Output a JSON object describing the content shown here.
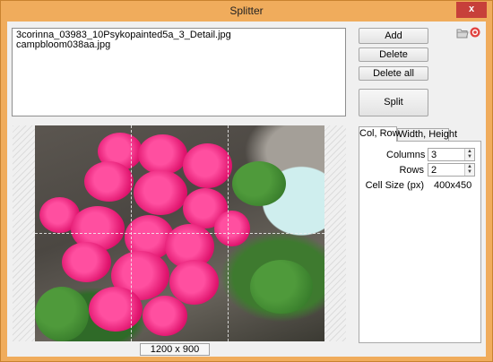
{
  "window": {
    "title": "Splitter",
    "close_label": "x"
  },
  "files": [
    "3corinna_03983_10Psykopainted5a_3_Detail.jpg",
    "campbloom038aa.jpg"
  ],
  "buttons": {
    "add": "Add",
    "delete": "Delete",
    "delete_all": "Delete all",
    "split": "Split"
  },
  "icons": {
    "open_folder": "folder-icon",
    "help": "help-icon"
  },
  "preview": {
    "dimensions": "1200 x 900",
    "columns": 3,
    "rows": 2
  },
  "tabs": [
    "Col, Row",
    "Width, Height"
  ],
  "settings": {
    "columns_label": "Columns",
    "columns_value": "3",
    "rows_label": "Rows",
    "rows_value": "2",
    "cell_size_label": "Cell Size (px)",
    "cell_size_value": "400x450"
  },
  "colors": {
    "titlebar": "#f0ac5c",
    "close": "#c7403a",
    "flower": "#e0146e"
  }
}
